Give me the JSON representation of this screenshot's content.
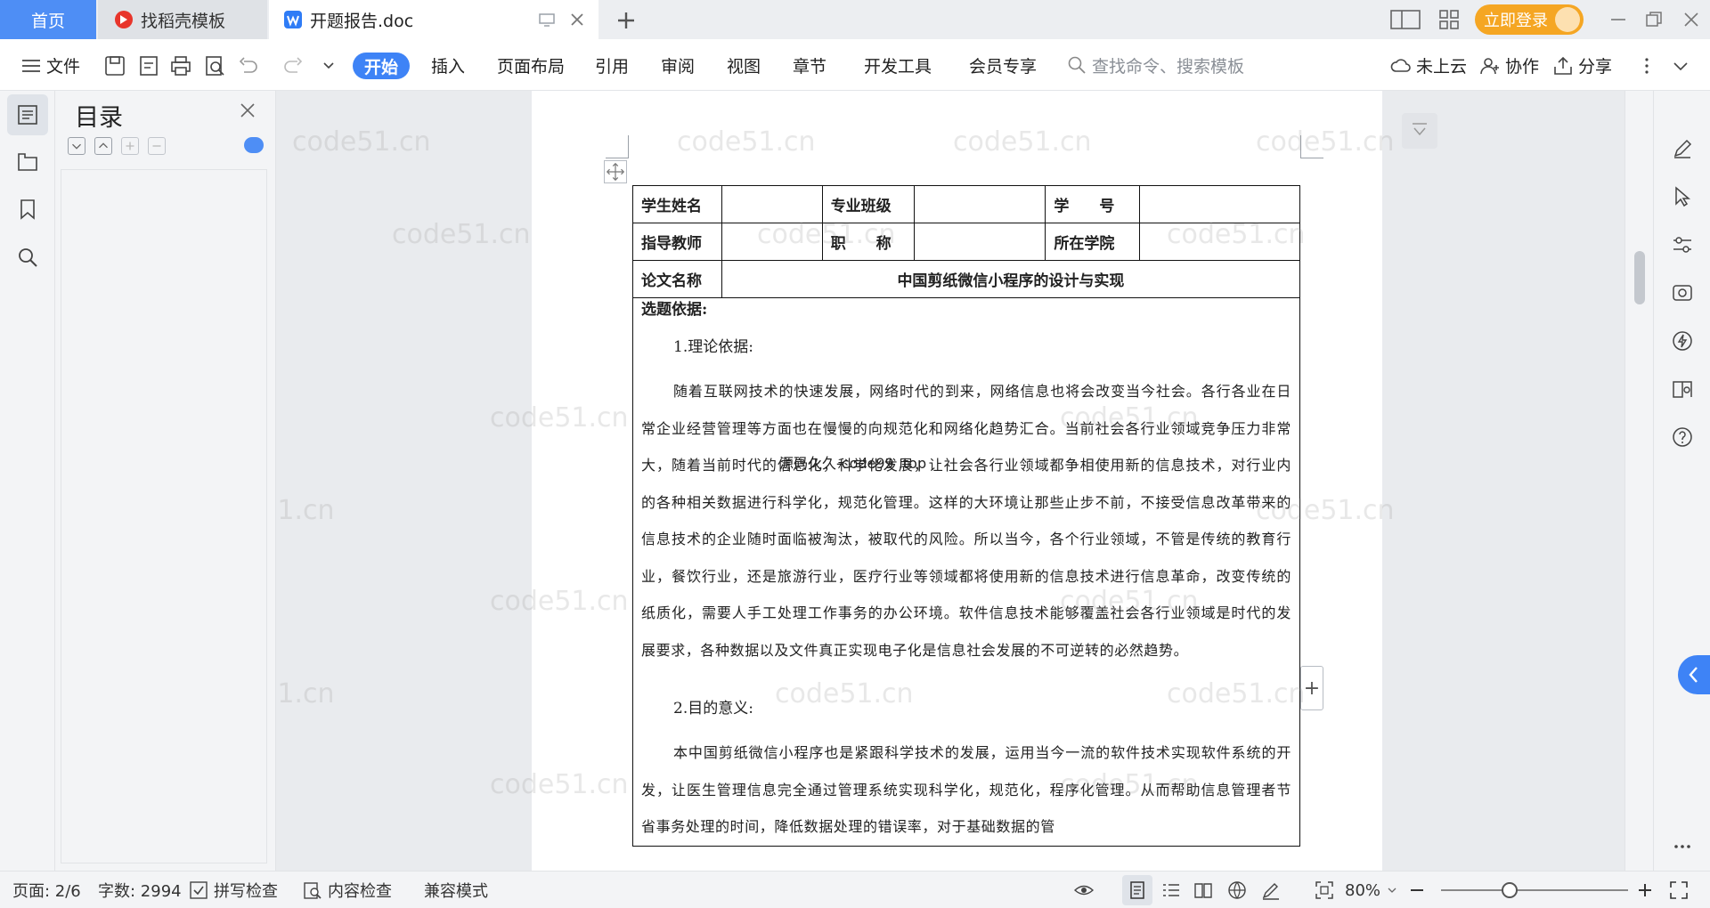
{
  "tabs": {
    "home": "首页",
    "templates": "找稻壳模板",
    "document": "开题报告.doc"
  },
  "title_bar": {
    "login_button": "立即登录"
  },
  "menu": {
    "file": "文件",
    "items": [
      "开始",
      "插入",
      "页面布局",
      "引用",
      "审阅",
      "视图",
      "章节",
      "开发工具",
      "会员专享"
    ],
    "search_placeholder": "查找命令、搜索模板",
    "cloud": "未上云",
    "collaborate": "协作",
    "share": "分享"
  },
  "toc": {
    "title": "目录"
  },
  "form": {
    "row1": {
      "student_name_label": "学生姓名",
      "major_class_label": "专业班级",
      "student_id_label": "学　　号"
    },
    "row2": {
      "advisor_label": "指导教师",
      "title_label": "职　　称",
      "college_label": "所在学院"
    },
    "row3": {
      "thesis_label": "论文名称",
      "thesis_title": "中国剪纸微信小程序的设计与实现"
    },
    "basis_heading": "选题依据:",
    "section1_heading": "1.理论依据:",
    "section1_text": "随着互联网技术的快速发展，网络时代的到来，网络信息也将会改变当今社会。各行各业在日常企业经营管理等方面也在慢慢的向规范化和网络化趋势汇合。当前社会各行业领域竞争压力非常大，随着当前时代的信息化，科学化发展，让社会各行业领域都争相使用新的信息技术，对行业内的各种相关数据进行科学化，规范化管理。这样的大环境让那些止步不前，不接受信息改革带来的信息技术的企业随时面临被淘汰，被取代的风险。所以当今，各个行业领域，不管是传统的教育行业，餐饮行业，还是旅游行业，医疗行业等领域都将使用新的信息技术进行信息革命，改变传统的纸质化，需要人手工处理工作事务的办公环境。软件信息技术能够覆盖社会各行业领域是时代的发展要求，各种数据以及文件真正实现电子化是信息社会发展的不可逆转的必然趋势。",
    "section2_heading": "2.目的意义:",
    "section2_text": "本中国剪纸微信小程序也是紧跟科学技术的发展，运用当今一流的软件技术实现软件系统的开发，让医生管理信息完全通过管理系统实现科学化，规范化，程序化管理。从而帮助信息管理者节省事务处理的时间，降低数据处理的错误率，对于基础数据的管"
  },
  "overlay": "源码久久-code99 .top",
  "watermark": "code51.cn",
  "status": {
    "page": "页面: 2/6",
    "words": "字数: 2994",
    "spellcheck": "拼写检查",
    "content_check": "内容检查",
    "compat_mode": "兼容模式",
    "zoom": "80%"
  },
  "colors": {
    "accent": "#3e83f6",
    "login": "#f5a623",
    "home_tab": "#4e8ef5"
  }
}
